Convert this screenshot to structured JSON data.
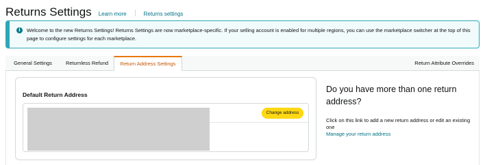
{
  "header": {
    "title": "Returns Settings",
    "learn_more": "Learn more",
    "returns_settings_link": "Returns settings"
  },
  "banner": {
    "icon": "info-icon",
    "text": "Welcome to the new Returns Settings! Returns Settings are now marketplace-specific. If your selling account is enabled for multiple regions, you can use the marketplace switcher at the top of this page to configure settings for each marketplace."
  },
  "tabs": {
    "items": [
      {
        "label": "General Settings"
      },
      {
        "label": "Returnless Refund"
      },
      {
        "label": "Return Address Settings"
      }
    ],
    "active": "Return Address Settings",
    "right_label": "Return Attribute Overrides"
  },
  "card": {
    "title": "Default Return Address",
    "change_button": "Change address"
  },
  "side": {
    "heading": "Do you have more than one return address?",
    "text": "Click on this link to add a new return address or edit an existing one",
    "link": "Manage your return address"
  },
  "colors": {
    "accent_teal": "#2fa7b5",
    "link": "#007185",
    "active_tab": "#c45500",
    "button_yellow": "#ffd814"
  }
}
